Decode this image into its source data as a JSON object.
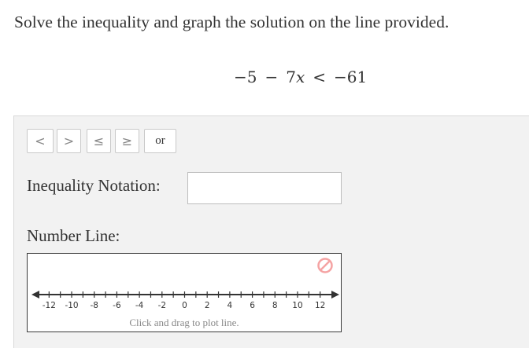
{
  "question": {
    "instruction": "Solve the inequality and graph the solution on the line provided.",
    "equation": {
      "lhs_const": "−5",
      "minus": "−",
      "coef": "7",
      "var": "x",
      "relation": "<",
      "rhs": "−61"
    }
  },
  "toolbar": {
    "buttons": [
      {
        "label": "<",
        "name": "less-than-button"
      },
      {
        "label": ">",
        "name": "greater-than-button"
      },
      {
        "label": "≤",
        "name": "less-equal-button"
      },
      {
        "label": "≥",
        "name": "greater-equal-button"
      },
      {
        "label": "or",
        "name": "or-button"
      }
    ]
  },
  "inequality": {
    "label": "Inequality Notation:",
    "value": "",
    "placeholder": ""
  },
  "number_line": {
    "label": "Number Line:",
    "hint": "Click and drag to plot line.",
    "clear_icon": "no-entry-icon",
    "range": [
      -13,
      13
    ],
    "tick_labels": [
      "-12",
      "-10",
      "-8",
      "-6",
      "-4",
      "-2",
      "0",
      "2",
      "4",
      "6",
      "8",
      "10",
      "12"
    ],
    "colors": {
      "axis": "#333333",
      "clear_icon": "#f5a3a3"
    }
  }
}
